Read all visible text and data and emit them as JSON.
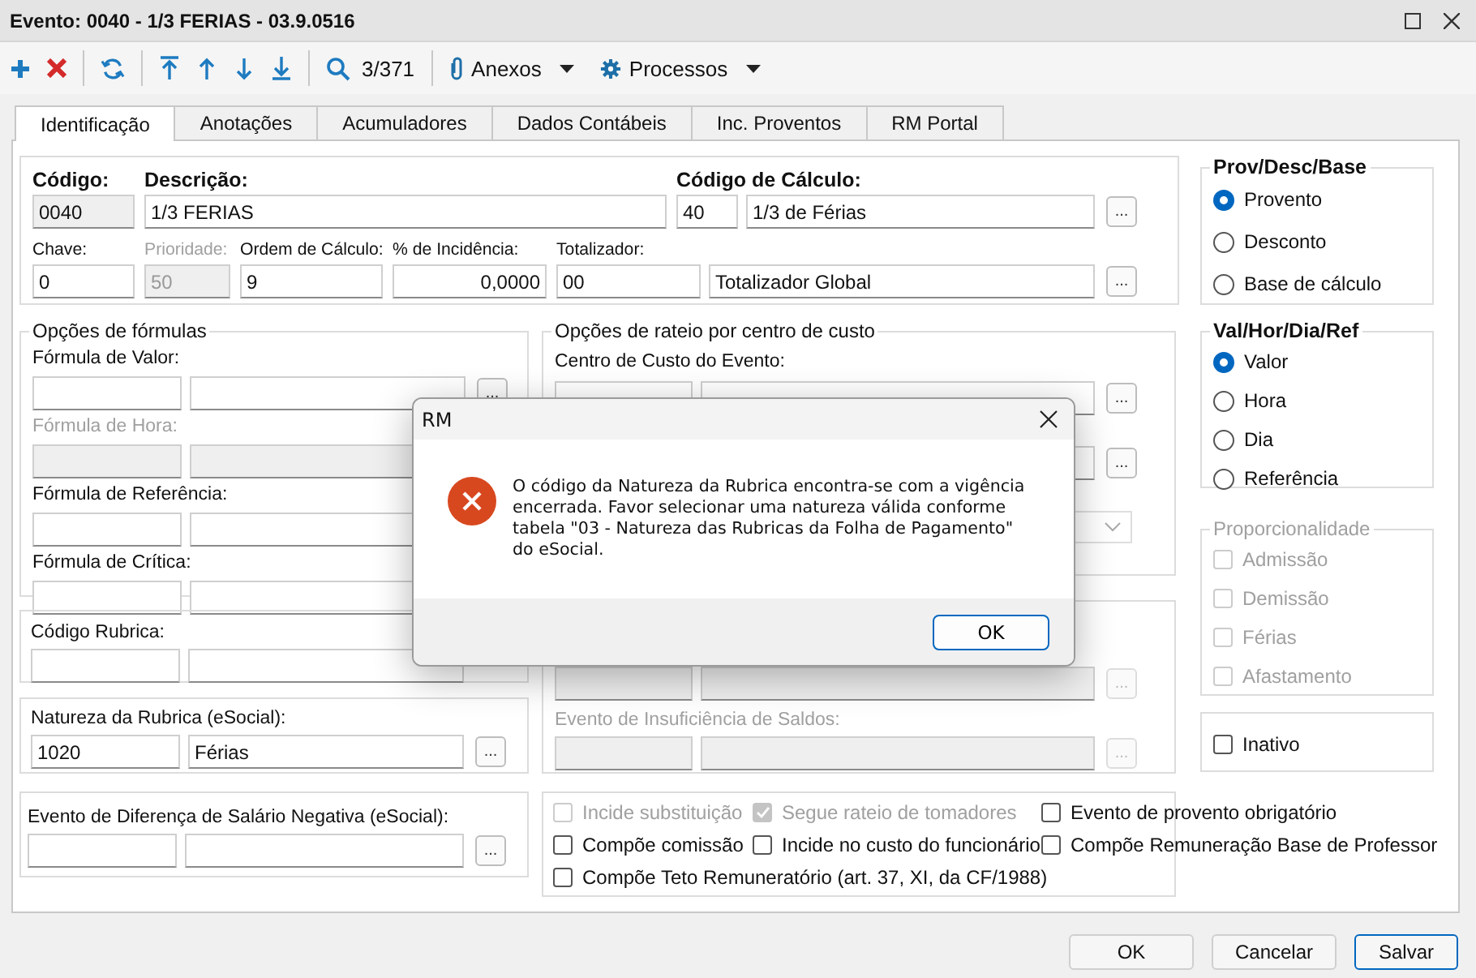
{
  "window": {
    "title": "Evento: 0040 - 1/3 FERIAS - 03.9.0516"
  },
  "toolbar": {
    "counter": "3/371",
    "menus": [
      {
        "kind": "clip",
        "label": "Anexos"
      },
      {
        "kind": "gear",
        "label": "Processos"
      }
    ]
  },
  "tabs": [
    {
      "label": "Identificação",
      "selected": true
    },
    {
      "label": "Anotações",
      "selected": false
    },
    {
      "label": "Acumuladores",
      "selected": false
    },
    {
      "label": "Dados Contábeis",
      "selected": false
    },
    {
      "label": "Inc. Proventos",
      "selected": false
    },
    {
      "label": "RM Portal",
      "selected": false
    }
  ],
  "header": {
    "codigo": {
      "label": "Código:",
      "value": "0040",
      "readonly": true
    },
    "descricao": {
      "label": "Descrição:",
      "value": "1/3 FERIAS"
    },
    "codigo_calculo": {
      "label": "Código de Cálculo:",
      "code": "40",
      "value": "1/3 de Férias",
      "lookup": "..."
    },
    "chave": {
      "label": "Chave:",
      "value": "0"
    },
    "prioridade": {
      "label": "Prioridade:",
      "value": "50",
      "disabled": true
    },
    "ordem": {
      "label": "Ordem de Cálculo:",
      "value": "9"
    },
    "incidencia": {
      "label": "% de Incidência:",
      "value": "0,0000"
    },
    "totalizador": {
      "label": "Totalizador:",
      "code": "00",
      "value": "Totalizador Global",
      "lookup": "..."
    }
  },
  "formulas": {
    "title": "Opções de fórmulas",
    "rows": [
      {
        "label": "Fórmula de Valor:",
        "disabled": false,
        "lookup": "..."
      },
      {
        "label": "Fórmula de Hora:",
        "disabled": true
      },
      {
        "label": "Fórmula de Referência:",
        "disabled": false
      },
      {
        "label": "Fórmula de Crítica:",
        "disabled": false
      }
    ]
  },
  "codigo_rubrica": {
    "label": "Código Rubrica:"
  },
  "natureza_rubrica": {
    "label": "Natureza da Rubrica (eSocial):",
    "code": "1020",
    "value": "Férias",
    "lookup": "..."
  },
  "evento_diferenca": {
    "label": "Evento de Diferença de Salário Negativa (eSocial):",
    "lookup": "..."
  },
  "rateio": {
    "title": "Opções de rateio por centro de custo",
    "label": "Centro de Custo do Evento:",
    "lookup": "...",
    "second_lookup": "..."
  },
  "saldos": {
    "rows": [
      {
        "disabled": true,
        "lookup": "..."
      },
      {
        "label": "Evento de Insuficiência de Saldos:",
        "disabled": true,
        "lookup": "..."
      }
    ]
  },
  "options": [
    {
      "label": "Incide substituição",
      "checked": false,
      "disabled": true
    },
    {
      "label": "Segue rateio de tomadores",
      "checked": true,
      "disabled": true
    },
    {
      "label": "Evento de provento obrigatório",
      "checked": false,
      "disabled": false
    },
    {
      "label": "Compõe comissão",
      "checked": false,
      "disabled": false
    },
    {
      "label": "Incide no custo do funcionário",
      "checked": false,
      "disabled": false
    },
    {
      "label": "Compõe Remuneração Base de Professor",
      "checked": false,
      "disabled": false
    },
    {
      "label": "Compõe Teto Remuneratório (art. 37, XI, da CF/1988)",
      "checked": false,
      "disabled": false
    }
  ],
  "prov_desc_base": {
    "title": "Prov/Desc/Base",
    "options": [
      {
        "label": "Provento",
        "selected": true
      },
      {
        "label": "Desconto",
        "selected": false
      },
      {
        "label": "Base de cálculo",
        "selected": false
      }
    ]
  },
  "val_hor_dia_ref": {
    "title": "Val/Hor/Dia/Ref",
    "options": [
      {
        "label": "Valor",
        "selected": true
      },
      {
        "label": "Hora",
        "selected": false
      },
      {
        "label": "Dia",
        "selected": false
      },
      {
        "label": "Referência",
        "selected": false
      }
    ]
  },
  "proporcionalidade": {
    "title": "Proporcionalidade",
    "items": [
      {
        "label": "Admissão",
        "checked": false,
        "disabled": true
      },
      {
        "label": "Demissão",
        "checked": false,
        "disabled": true
      },
      {
        "label": "Férias",
        "checked": false,
        "disabled": true
      },
      {
        "label": "Afastamento",
        "checked": false,
        "disabled": true
      }
    ]
  },
  "inativo": {
    "label": "Inativo",
    "checked": false
  },
  "dialog": {
    "title": "RM",
    "message": "O código da Natureza da Rubrica encontra-se com a vigência encerrada. Favor selecionar uma natureza válida conforme tabela \"03 - Natureza das Rubricas da Folha de Pagamento\" do eSocial.",
    "button": "OK"
  },
  "buttons": [
    {
      "label": "OK",
      "default": false
    },
    {
      "label": "Cancelar",
      "default": false
    },
    {
      "label": "Salvar",
      "default": true
    }
  ]
}
